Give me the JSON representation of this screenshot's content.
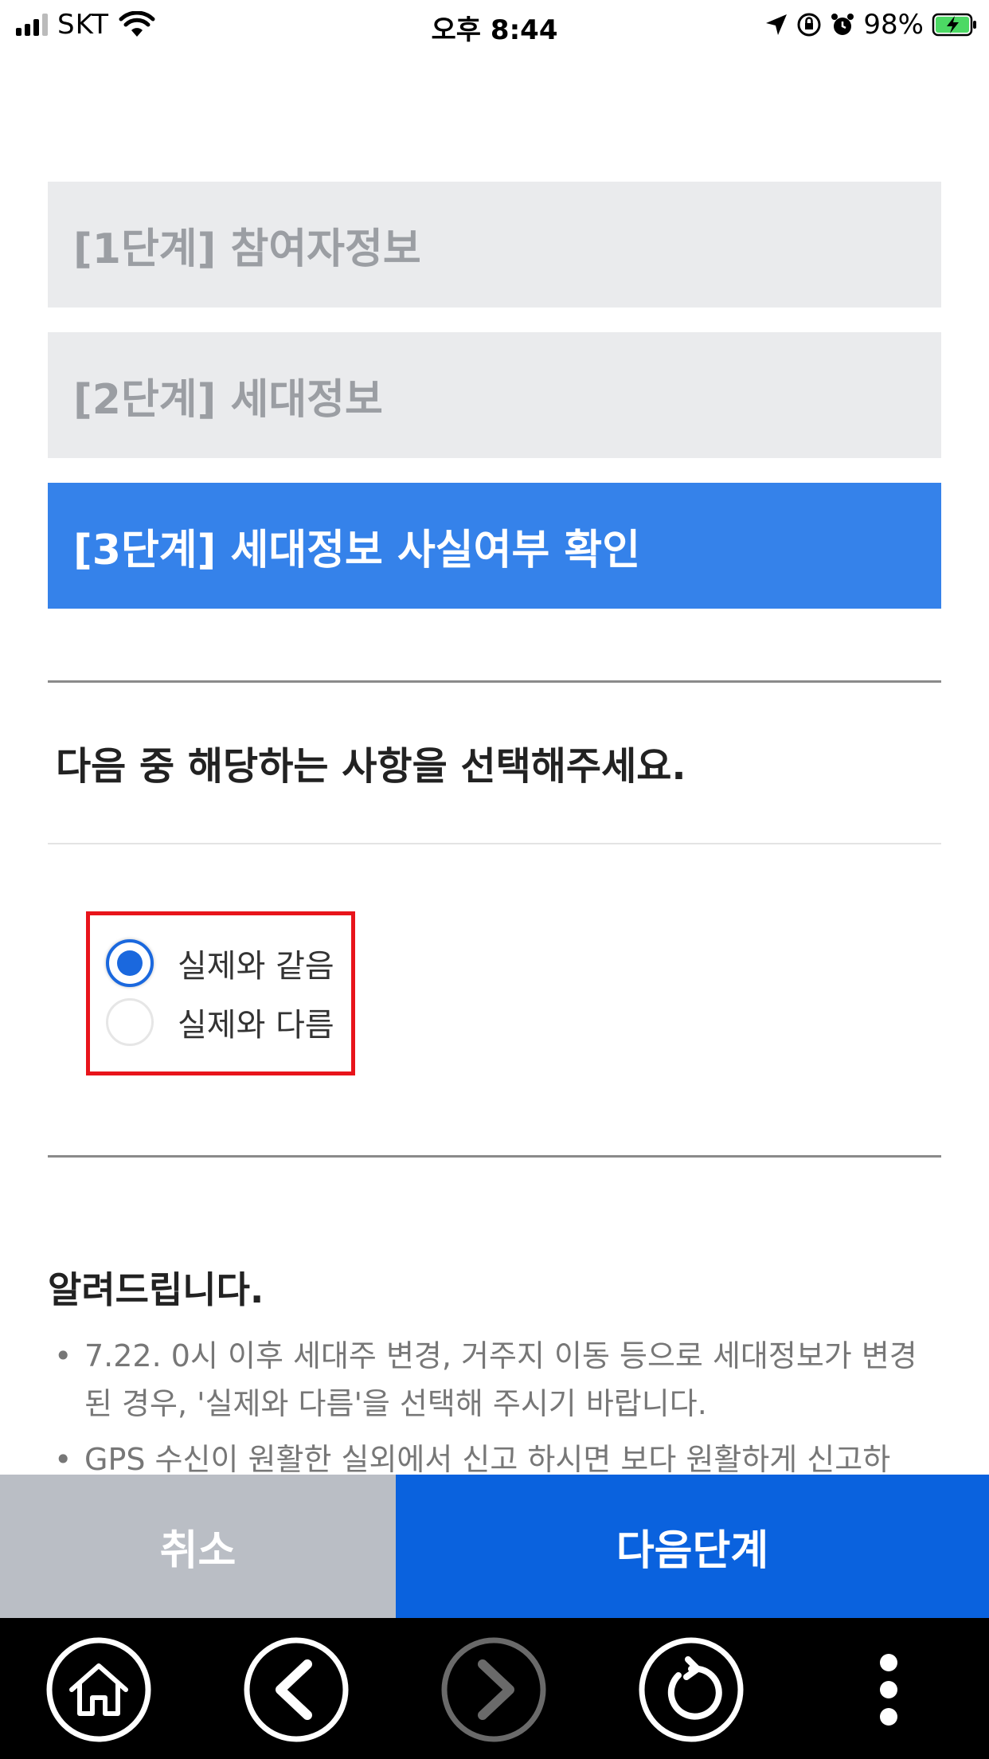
{
  "status_bar": {
    "carrier": "SKT",
    "time": "오후 8:44",
    "battery": "98%"
  },
  "steps": [
    {
      "label": "[1단계] 참여자정보",
      "state": "inactive"
    },
    {
      "label": "[2단계] 세대정보",
      "state": "inactive"
    },
    {
      "label": "[3단계] 세대정보 사실여부 확인",
      "state": "active"
    }
  ],
  "question": "다음 중 해당하는 사항을 선택해주세요.",
  "options": [
    {
      "label": "실제와 같음",
      "selected": true
    },
    {
      "label": "실제와 다름",
      "selected": false
    }
  ],
  "notice": {
    "title": "알려드립니다.",
    "items": [
      "7.22. 0시 이후 세대주 변경, 거주지 이동 등으로 세대정보가 변경된 경우, '실제와 다름'을 선택해 주시기 바랍니다.",
      "GPS 수신이 원활한 실외에서 신고 하시면 보다 원활하게 신고하"
    ]
  },
  "buttons": {
    "cancel": "취소",
    "next": "다음단계"
  },
  "colors": {
    "active_step": "#3582ea",
    "inactive_step": "#eaebed",
    "next_button": "#0a62de",
    "cancel_button": "#babec5",
    "highlight_box": "#e8141b",
    "radio": "#1a68de"
  },
  "nav_icons": [
    "home-icon",
    "back-icon",
    "forward-icon",
    "refresh-icon",
    "more-icon"
  ]
}
